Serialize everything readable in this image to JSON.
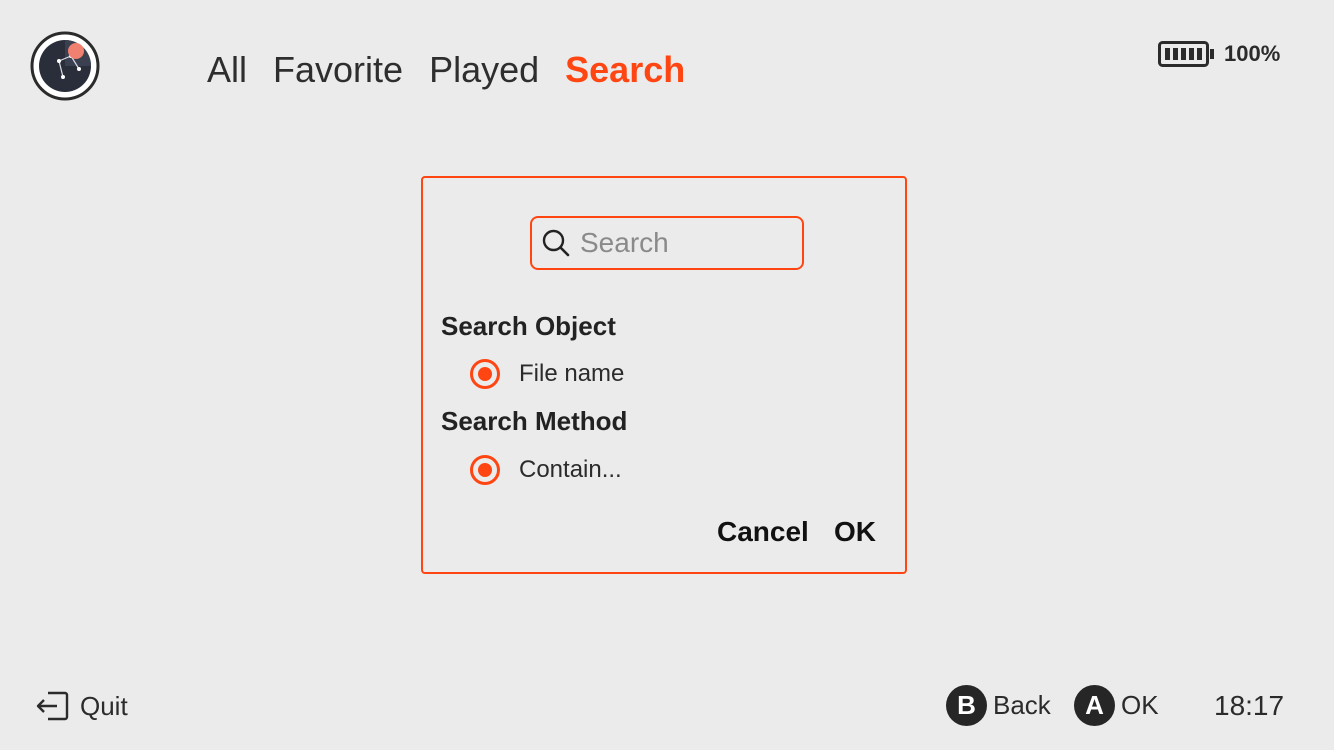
{
  "nav": {
    "tabs": [
      {
        "label": "All",
        "active": false
      },
      {
        "label": "Favorite",
        "active": false
      },
      {
        "label": "Played",
        "active": false
      },
      {
        "label": "Search",
        "active": true
      }
    ]
  },
  "status": {
    "battery_text": "100%",
    "battery_level": 1.0,
    "time": "18:17"
  },
  "dialog": {
    "search": {
      "placeholder": "Search",
      "value": ""
    },
    "search_object": {
      "title": "Search Object",
      "option": "File name",
      "selected": true
    },
    "search_method": {
      "title": "Search Method",
      "option": "Contain...",
      "selected": true
    },
    "cancel_label": "Cancel",
    "ok_label": "OK"
  },
  "footer": {
    "quit_label": "Quit",
    "back_key": "B",
    "back_label": "Back",
    "ok_key": "A",
    "ok_label": "OK"
  },
  "colors": {
    "accent": "#ff4612",
    "background": "#ebebeb",
    "text": "#2b2b2b"
  },
  "icons": [
    "app-logo",
    "battery-icon",
    "search-icon",
    "quit-icon"
  ]
}
